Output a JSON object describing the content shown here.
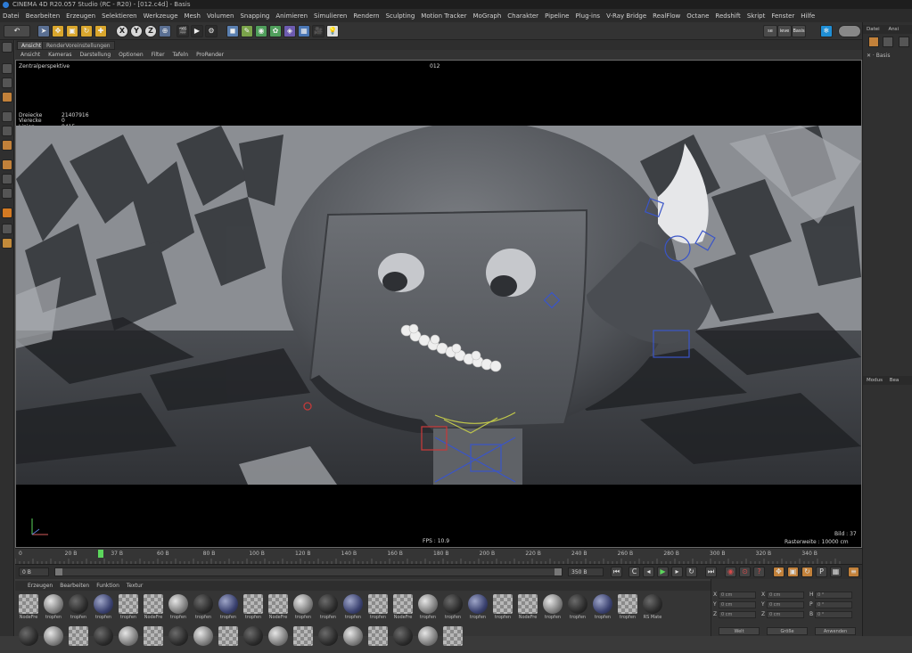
{
  "app": {
    "title": "CINEMA 4D R20.057 Studio (RC - R20) - [012.c4d] - Basis"
  },
  "menubar": {
    "items": [
      "Datei",
      "Bearbeiten",
      "Erzeugen",
      "Selektieren",
      "Werkzeuge",
      "Mesh",
      "Volumen",
      "Snapping",
      "Animieren",
      "Simulieren",
      "Rendern",
      "Sculpting",
      "Motion Tracker",
      "MoGraph",
      "Charakter",
      "Pipeline",
      "Plug-ins",
      "V-Ray Bridge",
      "RealFlow",
      "Octane",
      "Redshift",
      "Skript",
      "Fenster",
      "Hilfe"
    ]
  },
  "toolbar": {
    "axis_x": "X",
    "axis_y": "Y",
    "axis_z": "Z",
    "right_label_1": "se",
    "right_label_2": "ieve",
    "right_label_3": "Basis"
  },
  "viewport_tabs": {
    "tab1": "Ansicht",
    "tab2": "RenderVoreinstellungen"
  },
  "viewport_menu": {
    "items": [
      "Ansicht",
      "Kameras",
      "Darstellung",
      "Optionen",
      "Filter",
      "Tafeln",
      "ProRender"
    ]
  },
  "viewport": {
    "projection": "Zentralperspektive",
    "camera_label": "012",
    "stats": {
      "labels": [
        "Dreiecke",
        "Vierecke",
        "Linien",
        "Punkte",
        "Dreiecksvorlagen"
      ],
      "values": [
        "21407916",
        "0",
        "8415",
        "5",
        "0"
      ]
    },
    "fps": "FPS : 10.9",
    "frame": "Bild : 37",
    "grid": "Rasterweite : 10000 cm"
  },
  "timeline": {
    "ticks": [
      "0",
      "20 B",
      "37 B",
      "60 B",
      "80 B",
      "100 B",
      "120 B",
      "140 B",
      "160 B",
      "180 B",
      "200 B",
      "220 B",
      "240 B",
      "260 B",
      "280 B",
      "300 B",
      "320 B",
      "340 B"
    ],
    "current_frame": "37 B",
    "playhead_fraction": 0.1
  },
  "transport": {
    "start_field": "0 B",
    "end_field": "350 B"
  },
  "material_manager": {
    "menu": [
      "Erzeugen",
      "Bearbeiten",
      "Funktion",
      "Textur"
    ],
    "materials": [
      {
        "name": "NodeFre",
        "style": "chk"
      },
      {
        "name": "tropfen",
        "style": "grey"
      },
      {
        "name": "tropfen",
        "style": "dark"
      },
      {
        "name": "tropfen",
        "style": "blue"
      },
      {
        "name": "tropfen",
        "style": "chk"
      },
      {
        "name": "NodeFre",
        "style": "chk"
      },
      {
        "name": "tropfen",
        "style": "grey"
      },
      {
        "name": "tropfen",
        "style": "dark"
      },
      {
        "name": "tropfen",
        "style": "blue"
      },
      {
        "name": "tropfen",
        "style": "chk"
      },
      {
        "name": "NodeFre",
        "style": "chk"
      },
      {
        "name": "tropfen",
        "style": "grey"
      },
      {
        "name": "tropfen",
        "style": "dark"
      },
      {
        "name": "tropfen",
        "style": "blue"
      },
      {
        "name": "tropfen",
        "style": "chk"
      },
      {
        "name": "NodeFre",
        "style": "chk"
      },
      {
        "name": "tropfen",
        "style": "grey"
      },
      {
        "name": "tropfen",
        "style": "dark"
      },
      {
        "name": "tropfen",
        "style": "blue"
      },
      {
        "name": "tropfen",
        "style": "chk"
      },
      {
        "name": "NodeFre",
        "style": "chk"
      },
      {
        "name": "tropfen",
        "style": "grey"
      },
      {
        "name": "tropfen",
        "style": "dark"
      },
      {
        "name": "tropfen",
        "style": "blue"
      },
      {
        "name": "tropfen",
        "style": "chk"
      },
      {
        "name": "RS Mate",
        "style": "dark"
      }
    ]
  },
  "coordinates": {
    "rows": [
      {
        "axis": "X",
        "pos": "0 cm",
        "size_axis": "X",
        "size": "0 cm",
        "rot_axis": "H",
        "rot": "0 °"
      },
      {
        "axis": "Y",
        "pos": "0 cm",
        "size_axis": "Y",
        "size": "0 cm",
        "rot_axis": "P",
        "rot": "0 °"
      },
      {
        "axis": "Z",
        "pos": "0 cm",
        "size_axis": "Z",
        "size": "0 cm",
        "rot_axis": "B",
        "rot": "0 °"
      }
    ],
    "mode1": "Welt",
    "mode2": "Größe",
    "apply_button": "Anwenden"
  },
  "right_panel": {
    "top_tab1": "Datei",
    "top_tab2": "Ansi",
    "object_name": "Basis",
    "bottom_tab1": "Modus",
    "bottom_tab2": "Bea"
  }
}
